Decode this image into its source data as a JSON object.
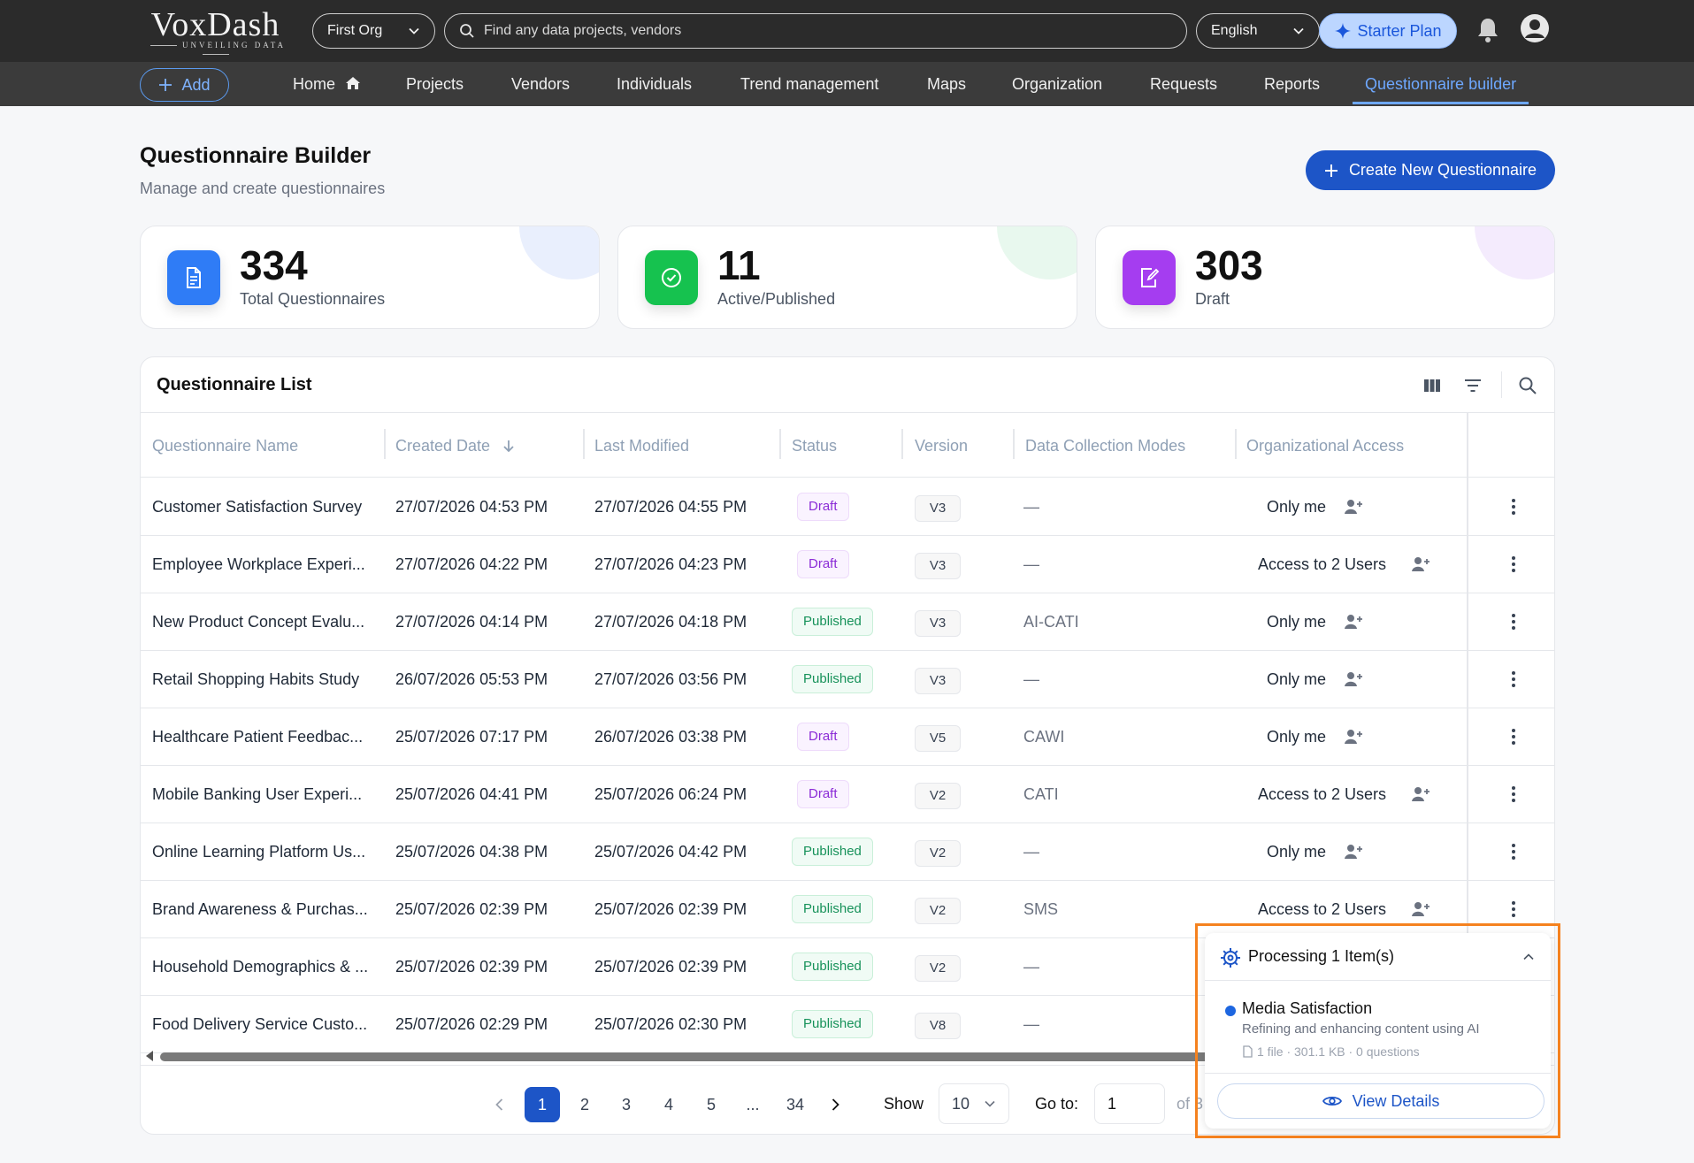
{
  "brand": {
    "name": "VoxDash",
    "tagline": "UNVEILING DATA"
  },
  "topbar": {
    "org": "First Org",
    "search_placeholder": "Find any data projects, vendors",
    "language": "English",
    "plan": "Starter Plan"
  },
  "nav": {
    "add_label": "Add",
    "items": [
      {
        "label": "Home"
      },
      {
        "label": "Projects"
      },
      {
        "label": "Vendors"
      },
      {
        "label": "Individuals"
      },
      {
        "label": "Trend management"
      },
      {
        "label": "Maps"
      },
      {
        "label": "Organization"
      },
      {
        "label": "Requests"
      },
      {
        "label": "Reports"
      },
      {
        "label": "Questionnaire builder",
        "active": true
      }
    ]
  },
  "header": {
    "title": "Questionnaire Builder",
    "subtitle": "Manage and create questionnaires",
    "create_label": "Create New Questionnaire"
  },
  "stats": [
    {
      "value": "334",
      "label": "Total Questionnaires",
      "color": "#2f7cf6"
    },
    {
      "value": "11",
      "label": "Active/Published",
      "color": "#16c24f"
    },
    {
      "value": "303",
      "label": "Draft",
      "color": "#a53df0"
    }
  ],
  "list": {
    "title": "Questionnaire List",
    "columns": [
      "Questionnaire Name",
      "Created Date",
      "Last Modified",
      "Status",
      "Version",
      "Data Collection Modes",
      "Organizational Access"
    ],
    "rows": [
      {
        "name": "Customer Satisfaction Survey",
        "created": "27/07/2026 04:53 PM",
        "modified": "27/07/2026 04:55 PM",
        "status": "Draft",
        "version": "V3",
        "mode": "—",
        "access": "Only me"
      },
      {
        "name": "Employee Workplace Experi...",
        "created": "27/07/2026 04:22 PM",
        "modified": "27/07/2026 04:23 PM",
        "status": "Draft",
        "version": "V3",
        "mode": "—",
        "access": "Access to 2 Users"
      },
      {
        "name": "New Product Concept Evalu...",
        "created": "27/07/2026 04:14 PM",
        "modified": "27/07/2026 04:18 PM",
        "status": "Published",
        "version": "V3",
        "mode": "AI-CATI",
        "access": "Only me"
      },
      {
        "name": "Retail Shopping Habits Study",
        "created": "26/07/2026 05:53 PM",
        "modified": "27/07/2026 03:56 PM",
        "status": "Published",
        "version": "V3",
        "mode": "—",
        "access": "Only me"
      },
      {
        "name": "Healthcare Patient Feedbac...",
        "created": "25/07/2026 07:17 PM",
        "modified": "26/07/2026 03:38 PM",
        "status": "Draft",
        "version": "V5",
        "mode": "CAWI",
        "access": "Only me"
      },
      {
        "name": "Mobile Banking User Experi...",
        "created": "25/07/2026 04:41 PM",
        "modified": "25/07/2026 06:24 PM",
        "status": "Draft",
        "version": "V2",
        "mode": "CATI",
        "access": "Access to 2 Users"
      },
      {
        "name": "Online Learning Platform Us...",
        "created": "25/07/2026 04:38 PM",
        "modified": "25/07/2026 04:42 PM",
        "status": "Published",
        "version": "V2",
        "mode": "—",
        "access": "Only me"
      },
      {
        "name": "Brand Awareness & Purchas...",
        "created": "25/07/2026 02:39 PM",
        "modified": "25/07/2026 02:39 PM",
        "status": "Published",
        "version": "V2",
        "mode": "SMS",
        "access": "Access to 2 Users"
      },
      {
        "name": "Household Demographics & ...",
        "created": "25/07/2026 02:39 PM",
        "modified": "25/07/2026 02:39 PM",
        "status": "Published",
        "version": "V2",
        "mode": "—",
        "access": ""
      },
      {
        "name": "Food Delivery Service Custo...",
        "created": "25/07/2026 02:29 PM",
        "modified": "25/07/2026 02:30 PM",
        "status": "Published",
        "version": "V8",
        "mode": "—",
        "access": ""
      }
    ]
  },
  "pagination": {
    "pages": [
      "1",
      "2",
      "3",
      "4",
      "5",
      "...",
      "34"
    ],
    "current": "1",
    "show_label": "Show",
    "page_size": "10",
    "goto_label": "Go to:",
    "goto_value": "1",
    "of_label": "of 3"
  },
  "processing": {
    "title": "Processing 1 Item(s)",
    "item_name": "Media Satisfaction",
    "item_desc": "Refining and enhancing content using AI",
    "item_meta": "1 file · 301.1 KB · 0 questions",
    "view_label": "View Details"
  }
}
